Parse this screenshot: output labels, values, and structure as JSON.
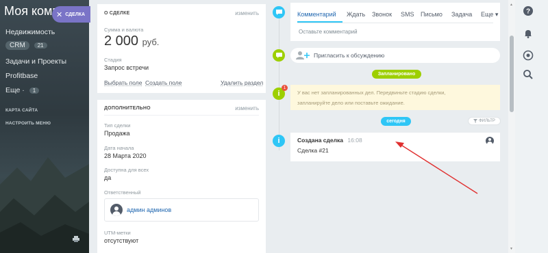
{
  "sidebar": {
    "title": "Моя компа",
    "items": [
      {
        "label": "Недвижимость"
      },
      {
        "label": "CRM",
        "badge": "21"
      },
      {
        "label": "Задачи и Проекты"
      },
      {
        "label": "Profitbase"
      },
      {
        "label": "Еще ·",
        "badge": "1"
      }
    ],
    "site_map": "КАРТА САЙТА",
    "settings_menu": "НАСТРОИТЬ МЕНЮ"
  },
  "deal_button": {
    "label": "СДЕЛКА",
    "close": "✕"
  },
  "about": {
    "header": "О СДЕЛКЕ",
    "edit": "изменить",
    "amount_label": "Сумма и валюта",
    "amount_value": "2 000",
    "currency": "руб.",
    "stage_label": "Стадия",
    "stage_value": "Запрос встречи",
    "choose_field": "Выбрать поле",
    "create_field": "Создать поле",
    "delete_section": "Удалить раздел"
  },
  "extra": {
    "header": "ДОПОЛНИТЕЛЬНО",
    "edit": "изменить",
    "type_label": "Тип сделки",
    "type_value": "Продажа",
    "start_label": "Дата начала",
    "start_value": "28 Марта 2020",
    "access_label": "Доступна для всех",
    "access_value": "да",
    "responsible_label": "Ответственный",
    "responsible_value": "админ админов",
    "utm_label": "UTM-метки",
    "utm_value": "отсутствуют"
  },
  "timeline": {
    "tabs": [
      "Комментарий",
      "Ждать",
      "Звонок",
      "SMS",
      "Письмо",
      "Задача",
      "Еще ▾"
    ],
    "comment_placeholder": "Оставьте комментарий",
    "invite": "Пригласить к обсуждению",
    "planned_label": "Запланировано",
    "warning_line1": "У вас нет запланированных дел. Передвиньте стадию сделки,",
    "warning_line2": "запланируйте дело или поставьте ожидание.",
    "today_label": "сегодня",
    "filter_label": "ФИЛЬТР",
    "notify_count": "1",
    "deal_created": "Создана сделка",
    "deal_time": "16:08",
    "deal_number": "Сделка #21"
  },
  "right_panel": {
    "icons": [
      "help-icon",
      "bell-icon",
      "chat-icon",
      "search-icon"
    ]
  },
  "colors": {
    "accent_blue": "#2fc6f6",
    "green": "#9dcf00",
    "purple": "#7a74c7",
    "arrow_red": "#e03030"
  }
}
